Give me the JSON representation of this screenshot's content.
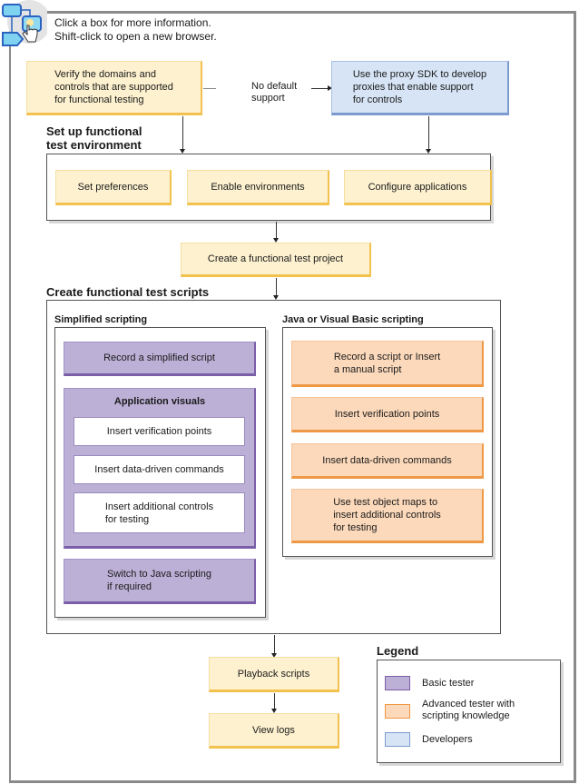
{
  "header": {
    "icon": "flowchart-click-icon",
    "line1": "Click a box for more information.",
    "line2": "Shift-click to open a new browser."
  },
  "top": {
    "verify_box": [
      "Verify the domains and",
      "controls that are supported",
      "for functional testing"
    ],
    "no_default": [
      "No default",
      "support"
    ],
    "proxy_box": [
      "Use the proxy SDK to develop",
      "proxies that enable support",
      "for controls"
    ]
  },
  "setup": {
    "title": [
      "Set up functional",
      "test environment"
    ],
    "items": [
      "Set preferences",
      "Enable environments",
      "Configure applications"
    ]
  },
  "create_project": "Create a functional test project",
  "scripts": {
    "title": "Create functional test scripts",
    "simplified": {
      "title": "Simplified scripting",
      "record": "Record a simplified script",
      "visuals_title": "Application visuals",
      "visuals_items": [
        "Insert verification points",
        "Insert data-driven commands",
        [
          "Insert additional controls",
          "for testing"
        ]
      ],
      "switch": [
        "Switch to Java scripting",
        "if required"
      ]
    },
    "java": {
      "title": "Java or Visual Basic scripting",
      "items": [
        [
          "Record a script or Insert",
          "a manual script"
        ],
        [
          "Insert verification points"
        ],
        [
          "Insert data-driven commands"
        ],
        [
          "Use test object maps to",
          "insert additional controls",
          "for testing"
        ]
      ]
    }
  },
  "playback": "Playback scripts",
  "view_logs": "View logs",
  "legend": {
    "title": "Legend",
    "items": [
      {
        "label": [
          "Basic tester"
        ],
        "color": "#bcb0d6"
      },
      {
        "label": [
          "Advanced tester with",
          "scripting knowledge"
        ],
        "color": "#fcd9bb"
      },
      {
        "label": [
          "Developers"
        ],
        "color": "#d6e4f5"
      }
    ]
  }
}
